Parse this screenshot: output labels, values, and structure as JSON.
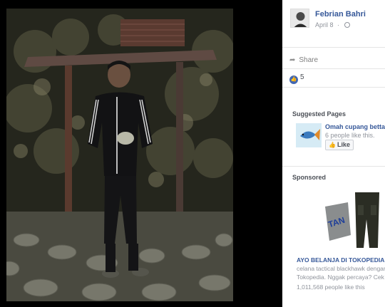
{
  "post": {
    "author_name": "Febrian Bahri",
    "date": "April 8",
    "privacy_icon": "globe-icon"
  },
  "actions": {
    "share_label": "Share",
    "like_count": "5"
  },
  "suggested": {
    "title": "Suggested Pages",
    "page_name": "Omah cupang bettahol",
    "page_likes": "6 people like this.",
    "like_button": "Like"
  },
  "sponsored": {
    "title": "Sponsored",
    "ad_title": "AYO BELANJA DI TOKOPEDIA",
    "ad_line_1": "celana tactical blackhawk dengan",
    "ad_line_2": "Tokopedia. Nggak percaya? Cek",
    "ad_likes": "1,011,568 people like this",
    "ad_image_text": "TAN"
  },
  "colors": {
    "link_blue": "#365899",
    "like_blue": "#4267b2",
    "muted": "#90949c"
  }
}
